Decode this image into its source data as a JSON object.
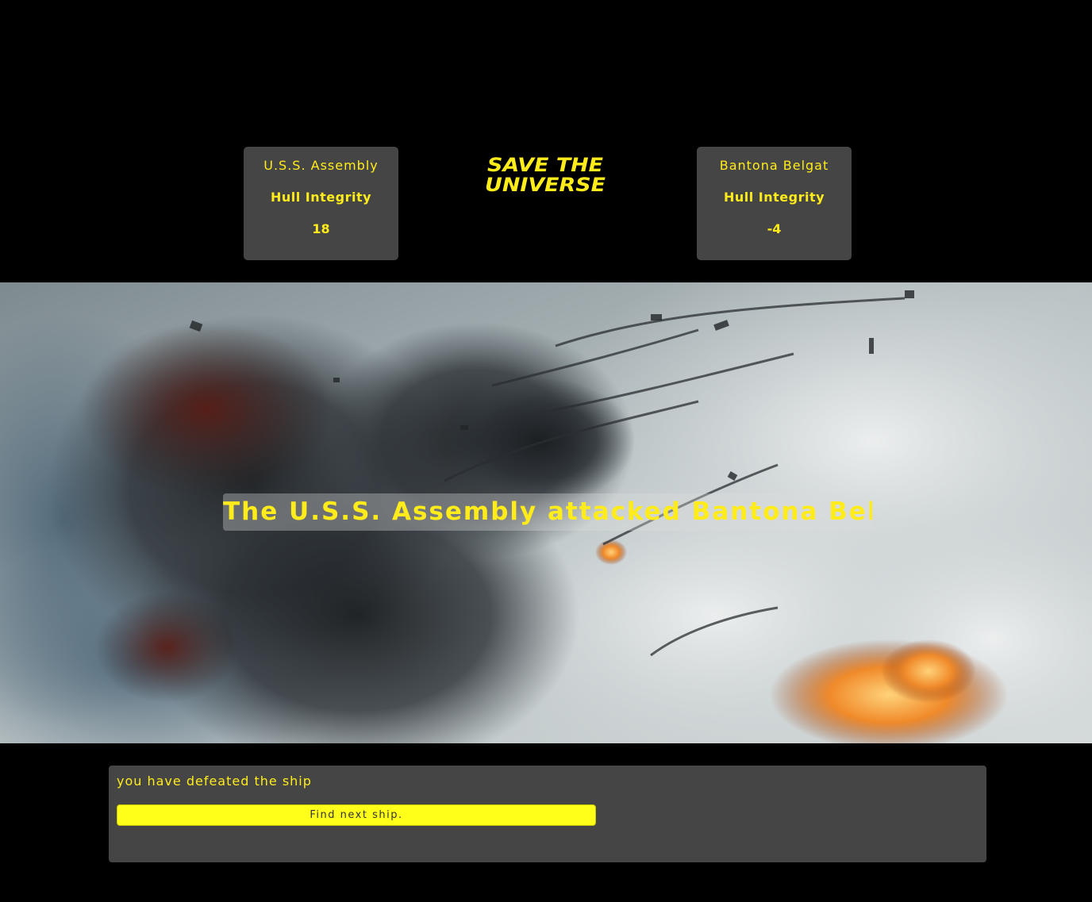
{
  "logo": {
    "line1": "SAVE THE",
    "line2": "UNIVERSE"
  },
  "player": {
    "name": "U.S.S. Assembly",
    "hull_label": "Hull Integrity",
    "hull_value": "18"
  },
  "enemy": {
    "name": "Bantona Belgat",
    "hull_label": "Hull Integrity",
    "hull_value": "-4"
  },
  "battle": {
    "caption": "The U.S.S. Assembly attacked Bantona Belgat",
    "scene": "space battle explosion"
  },
  "message": {
    "text": "you have defeated the ship",
    "button_label": "Find next ship."
  },
  "colors": {
    "accent": "#ffec1a",
    "panel": "#454545",
    "background": "#000000"
  }
}
